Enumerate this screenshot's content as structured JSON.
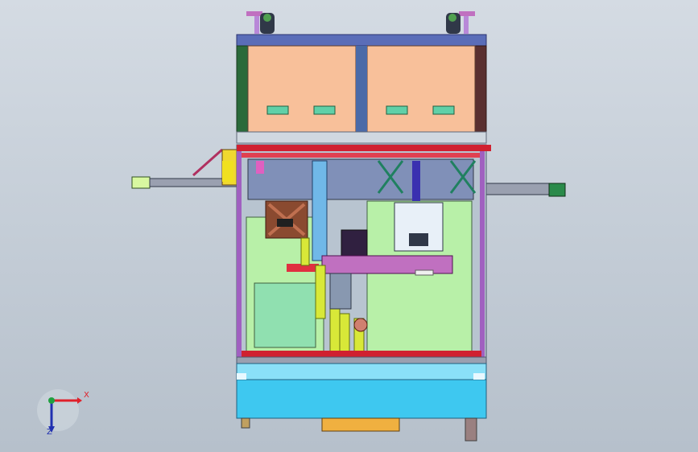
{
  "axes": {
    "x_label": "X",
    "z_label": "Z"
  },
  "colors": {
    "background_top": "#d4dbe3",
    "frame_blue": "#5a6db8",
    "top_panel": "#f8c09a",
    "panel_green": "#b8f0a8",
    "base_cyan": "#3ec8f0",
    "yellow_cylinder": "#d8e838",
    "red_rail": "#d02030",
    "magenta": "#c020c0",
    "dark_green": "#2a6a3a"
  }
}
